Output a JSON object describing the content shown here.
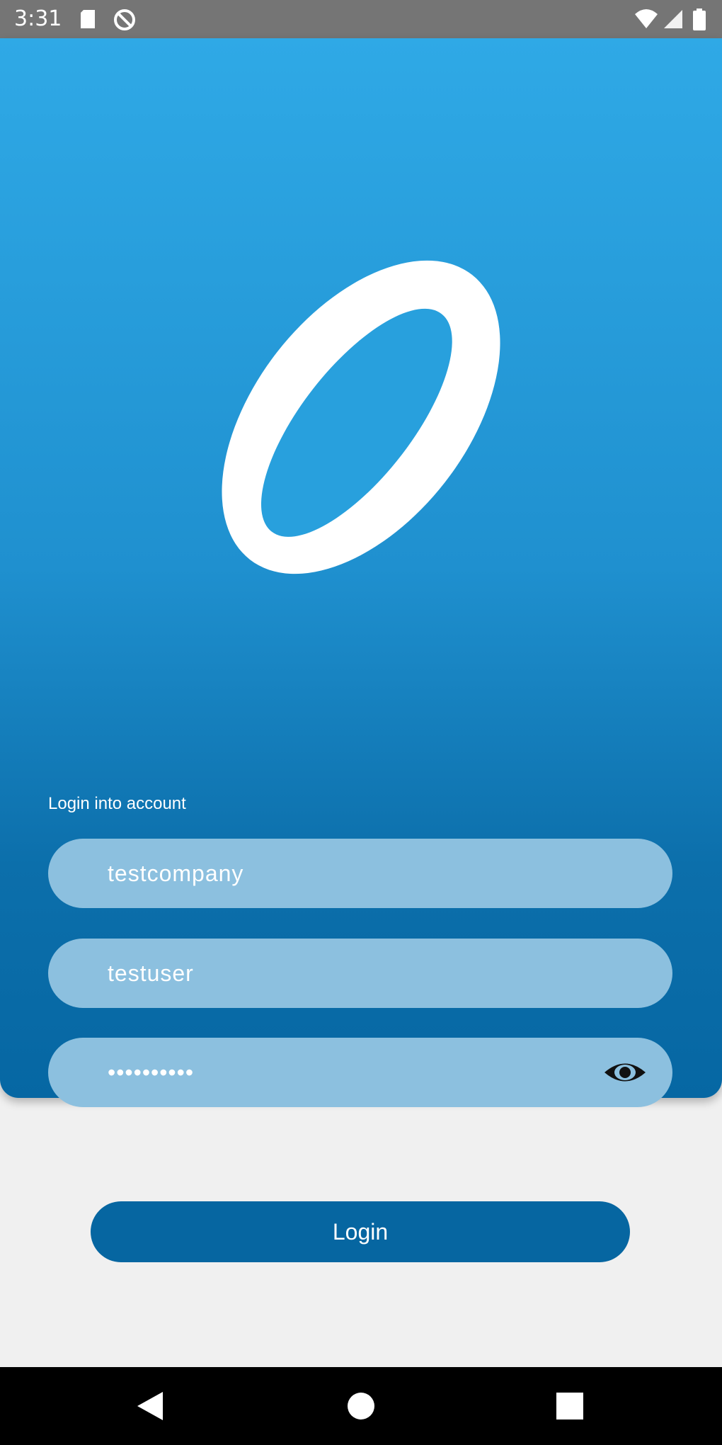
{
  "status_bar": {
    "time": "3:31"
  },
  "login_card": {
    "section_label": "Login into account",
    "company_field": {
      "value": "testcompany"
    },
    "user_field": {
      "value": "testuser"
    },
    "password_field": {
      "value": "••••••••••"
    }
  },
  "login_button": {
    "label": "Login"
  },
  "colors": {
    "gradient_top": "#2fa9e6",
    "gradient_bottom": "#0667a3",
    "field_background": "#8cc0df",
    "button_background": "#0666a1"
  }
}
